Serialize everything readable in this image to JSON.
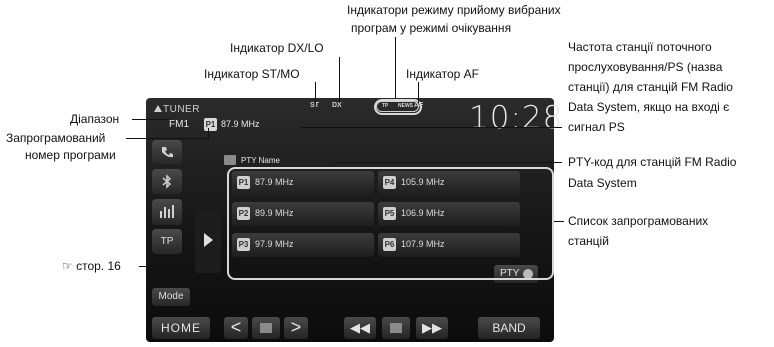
{
  "screen": {
    "source": "TUNER",
    "band": "FM1",
    "current_preset_number": "P1",
    "current_frequency": "87.9 MHz",
    "indicators": {
      "st": "ST",
      "dx": "DX",
      "af": "AF",
      "tp": "TP",
      "news": "NEWS"
    },
    "clock": "10:28",
    "pty_name": "PTY Name",
    "left_buttons": {
      "tp": "TP"
    },
    "presets": [
      {
        "num": "P1",
        "freq": "87.9 MHz"
      },
      {
        "num": "P4",
        "freq": "105.9 MHz"
      },
      {
        "num": "P2",
        "freq": "89.9 MHz"
      },
      {
        "num": "P5",
        "freq": "106.9 MHz"
      },
      {
        "num": "P3",
        "freq": "97.9 MHz"
      },
      {
        "num": "P6",
        "freq": "107.9 MHz"
      }
    ],
    "buttons": {
      "mode": "Mode",
      "pty": "PTY",
      "home": "HOME",
      "band": "BAND",
      "prev": "<",
      "next": ">",
      "seek_back": "◀◀",
      "seek_fwd": "▶▶"
    }
  },
  "callouts": {
    "standby": [
      "Індикатори режиму прийому вибраних",
      "програм у режимі очікування"
    ],
    "dx": "Індикатор DX/LO",
    "st": "Індикатор ST/MO",
    "af": "Індикатор AF",
    "frequency": [
      "Частота станції поточного",
      "прослуховування/PS (назва",
      "станції) для станцій FM Radio",
      "Data System, якщо на вході є",
      "сигнал PS"
    ],
    "band": "Діапазон",
    "preset": [
      "Запрограмований",
      "номер програми"
    ],
    "pty": [
      "PTY-код для станцій FM Radio",
      "Data System"
    ],
    "preset_list": [
      "Список запрограмованих",
      "станцій"
    ],
    "page_ref": "☞ стор. 16"
  }
}
